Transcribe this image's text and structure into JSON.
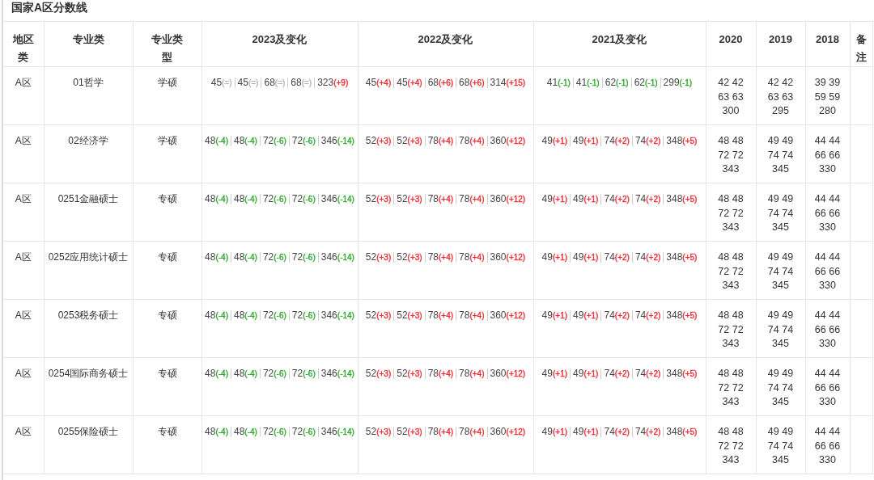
{
  "title": "国家A区分数线",
  "columns": [
    "地区类",
    "专业类",
    "专业类型",
    "2023及变化",
    "2022及变化",
    "2021及变化",
    "2020",
    "2019",
    "2018",
    "备注"
  ],
  "rows": [
    {
      "region": "A区",
      "major": "01哲学",
      "type": "学硕",
      "changes": [
        [
          {
            "value": "45",
            "delta": "(=)",
            "color": "#b3b3b3"
          },
          {
            "value": "45",
            "delta": "(=)",
            "color": "#b3b3b3"
          },
          {
            "value": "68",
            "delta": "(=)",
            "color": "#b3b3b3"
          },
          {
            "value": "68",
            "delta": "(=)",
            "color": "#b3b3b3"
          },
          {
            "value": "323",
            "delta": "(+9)",
            "color": "#f0282d"
          }
        ],
        [
          {
            "value": "45",
            "delta": "(+4)",
            "color": "#f0282d"
          },
          {
            "value": "45",
            "delta": "(+4)",
            "color": "#f0282d"
          },
          {
            "value": "68",
            "delta": "(+6)",
            "color": "#f0282d"
          },
          {
            "value": "68",
            "delta": "(+6)",
            "color": "#f0282d"
          },
          {
            "value": "314",
            "delta": "(+15)",
            "color": "#f0282d"
          }
        ],
        [
          {
            "value": "41",
            "delta": "(-1)",
            "color": "#2ea52e"
          },
          {
            "value": "41",
            "delta": "(-1)",
            "color": "#2ea52e"
          },
          {
            "value": "62",
            "delta": "(-1)",
            "color": "#2ea52e"
          },
          {
            "value": "62",
            "delta": "(-1)",
            "color": "#2ea52e"
          },
          {
            "value": "299",
            "delta": "(-1)",
            "color": "#2ea52e"
          }
        ]
      ],
      "years": [
        "42 42 63 63 300",
        "42 42 63 63 295",
        "39 39 59 59 280"
      ]
    },
    {
      "region": "A区",
      "major": "02经济学",
      "type": "学硕",
      "changes": [
        [
          {
            "value": "48",
            "delta": "(-4)",
            "color": "#2ea52e"
          },
          {
            "value": "48",
            "delta": "(-4)",
            "color": "#2ea52e"
          },
          {
            "value": "72",
            "delta": "(-6)",
            "color": "#2ea52e"
          },
          {
            "value": "72",
            "delta": "(-6)",
            "color": "#2ea52e"
          },
          {
            "value": "346",
            "delta": "(-14)",
            "color": "#2ea52e"
          }
        ],
        [
          {
            "value": "52",
            "delta": "(+3)",
            "color": "#f0282d"
          },
          {
            "value": "52",
            "delta": "(+3)",
            "color": "#f0282d"
          },
          {
            "value": "78",
            "delta": "(+4)",
            "color": "#f0282d"
          },
          {
            "value": "78",
            "delta": "(+4)",
            "color": "#f0282d"
          },
          {
            "value": "360",
            "delta": "(+12)",
            "color": "#f0282d"
          }
        ],
        [
          {
            "value": "49",
            "delta": "(+1)",
            "color": "#f0282d"
          },
          {
            "value": "49",
            "delta": "(+1)",
            "color": "#f0282d"
          },
          {
            "value": "74",
            "delta": "(+2)",
            "color": "#f0282d"
          },
          {
            "value": "74",
            "delta": "(+2)",
            "color": "#f0282d"
          },
          {
            "value": "348",
            "delta": "(+5)",
            "color": "#f0282d"
          }
        ]
      ],
      "years": [
        "48 48 72 72 343",
        "49 49 74 74 345",
        "44 44 66 66 330"
      ]
    },
    {
      "region": "A区",
      "major": "0251金融硕士",
      "type": "专硕",
      "changes": [
        [
          {
            "value": "48",
            "delta": "(-4)",
            "color": "#2ea52e"
          },
          {
            "value": "48",
            "delta": "(-4)",
            "color": "#2ea52e"
          },
          {
            "value": "72",
            "delta": "(-6)",
            "color": "#2ea52e"
          },
          {
            "value": "72",
            "delta": "(-6)",
            "color": "#2ea52e"
          },
          {
            "value": "346",
            "delta": "(-14)",
            "color": "#2ea52e"
          }
        ],
        [
          {
            "value": "52",
            "delta": "(+3)",
            "color": "#f0282d"
          },
          {
            "value": "52",
            "delta": "(+3)",
            "color": "#f0282d"
          },
          {
            "value": "78",
            "delta": "(+4)",
            "color": "#f0282d"
          },
          {
            "value": "78",
            "delta": "(+4)",
            "color": "#f0282d"
          },
          {
            "value": "360",
            "delta": "(+12)",
            "color": "#f0282d"
          }
        ],
        [
          {
            "value": "49",
            "delta": "(+1)",
            "color": "#f0282d"
          },
          {
            "value": "49",
            "delta": "(+1)",
            "color": "#f0282d"
          },
          {
            "value": "74",
            "delta": "(+2)",
            "color": "#f0282d"
          },
          {
            "value": "74",
            "delta": "(+2)",
            "color": "#f0282d"
          },
          {
            "value": "348",
            "delta": "(+5)",
            "color": "#f0282d"
          }
        ]
      ],
      "years": [
        "48 48 72 72 343",
        "49 49 74 74 345",
        "44 44 66 66 330"
      ]
    },
    {
      "region": "A区",
      "major": "0252应用统计硕士",
      "type": "专硕",
      "changes": [
        [
          {
            "value": "48",
            "delta": "(-4)",
            "color": "#2ea52e"
          },
          {
            "value": "48",
            "delta": "(-4)",
            "color": "#2ea52e"
          },
          {
            "value": "72",
            "delta": "(-6)",
            "color": "#2ea52e"
          },
          {
            "value": "72",
            "delta": "(-6)",
            "color": "#2ea52e"
          },
          {
            "value": "346",
            "delta": "(-14)",
            "color": "#2ea52e"
          }
        ],
        [
          {
            "value": "52",
            "delta": "(+3)",
            "color": "#f0282d"
          },
          {
            "value": "52",
            "delta": "(+3)",
            "color": "#f0282d"
          },
          {
            "value": "78",
            "delta": "(+4)",
            "color": "#f0282d"
          },
          {
            "value": "78",
            "delta": "(+4)",
            "color": "#f0282d"
          },
          {
            "value": "360",
            "delta": "(+12)",
            "color": "#f0282d"
          }
        ],
        [
          {
            "value": "49",
            "delta": "(+1)",
            "color": "#f0282d"
          },
          {
            "value": "49",
            "delta": "(+1)",
            "color": "#f0282d"
          },
          {
            "value": "74",
            "delta": "(+2)",
            "color": "#f0282d"
          },
          {
            "value": "74",
            "delta": "(+2)",
            "color": "#f0282d"
          },
          {
            "value": "348",
            "delta": "(+5)",
            "color": "#f0282d"
          }
        ]
      ],
      "years": [
        "48 48 72 72 343",
        "49 49 74 74 345",
        "44 44 66 66 330"
      ]
    },
    {
      "region": "A区",
      "major": "0253税务硕士",
      "type": "专硕",
      "changes": [
        [
          {
            "value": "48",
            "delta": "(-4)",
            "color": "#2ea52e"
          },
          {
            "value": "48",
            "delta": "(-4)",
            "color": "#2ea52e"
          },
          {
            "value": "72",
            "delta": "(-6)",
            "color": "#2ea52e"
          },
          {
            "value": "72",
            "delta": "(-6)",
            "color": "#2ea52e"
          },
          {
            "value": "346",
            "delta": "(-14)",
            "color": "#2ea52e"
          }
        ],
        [
          {
            "value": "52",
            "delta": "(+3)",
            "color": "#f0282d"
          },
          {
            "value": "52",
            "delta": "(+3)",
            "color": "#f0282d"
          },
          {
            "value": "78",
            "delta": "(+4)",
            "color": "#f0282d"
          },
          {
            "value": "78",
            "delta": "(+4)",
            "color": "#f0282d"
          },
          {
            "value": "360",
            "delta": "(+12)",
            "color": "#f0282d"
          }
        ],
        [
          {
            "value": "49",
            "delta": "(+1)",
            "color": "#f0282d"
          },
          {
            "value": "49",
            "delta": "(+1)",
            "color": "#f0282d"
          },
          {
            "value": "74",
            "delta": "(+2)",
            "color": "#f0282d"
          },
          {
            "value": "74",
            "delta": "(+2)",
            "color": "#f0282d"
          },
          {
            "value": "348",
            "delta": "(+5)",
            "color": "#f0282d"
          }
        ]
      ],
      "years": [
        "48 48 72 72 343",
        "49 49 74 74 345",
        "44 44 66 66 330"
      ]
    },
    {
      "region": "A区",
      "major": "0254国际商务硕士",
      "type": "专硕",
      "changes": [
        [
          {
            "value": "48",
            "delta": "(-4)",
            "color": "#2ea52e"
          },
          {
            "value": "48",
            "delta": "(-4)",
            "color": "#2ea52e"
          },
          {
            "value": "72",
            "delta": "(-6)",
            "color": "#2ea52e"
          },
          {
            "value": "72",
            "delta": "(-6)",
            "color": "#2ea52e"
          },
          {
            "value": "346",
            "delta": "(-14)",
            "color": "#2ea52e"
          }
        ],
        [
          {
            "value": "52",
            "delta": "(+3)",
            "color": "#f0282d"
          },
          {
            "value": "52",
            "delta": "(+3)",
            "color": "#f0282d"
          },
          {
            "value": "78",
            "delta": "(+4)",
            "color": "#f0282d"
          },
          {
            "value": "78",
            "delta": "(+4)",
            "color": "#f0282d"
          },
          {
            "value": "360",
            "delta": "(+12)",
            "color": "#f0282d"
          }
        ],
        [
          {
            "value": "49",
            "delta": "(+1)",
            "color": "#f0282d"
          },
          {
            "value": "49",
            "delta": "(+1)",
            "color": "#f0282d"
          },
          {
            "value": "74",
            "delta": "(+2)",
            "color": "#f0282d"
          },
          {
            "value": "74",
            "delta": "(+2)",
            "color": "#f0282d"
          },
          {
            "value": "348",
            "delta": "(+5)",
            "color": "#f0282d"
          }
        ]
      ],
      "years": [
        "48 48 72 72 343",
        "49 49 74 74 345",
        "44 44 66 66 330"
      ]
    },
    {
      "region": "A区",
      "major": "0255保险硕士",
      "type": "专硕",
      "changes": [
        [
          {
            "value": "48",
            "delta": "(-4)",
            "color": "#2ea52e"
          },
          {
            "value": "48",
            "delta": "(-4)",
            "color": "#2ea52e"
          },
          {
            "value": "72",
            "delta": "(-6)",
            "color": "#2ea52e"
          },
          {
            "value": "72",
            "delta": "(-6)",
            "color": "#2ea52e"
          },
          {
            "value": "346",
            "delta": "(-14)",
            "color": "#2ea52e"
          }
        ],
        [
          {
            "value": "52",
            "delta": "(+3)",
            "color": "#f0282d"
          },
          {
            "value": "52",
            "delta": "(+3)",
            "color": "#f0282d"
          },
          {
            "value": "78",
            "delta": "(+4)",
            "color": "#f0282d"
          },
          {
            "value": "78",
            "delta": "(+4)",
            "color": "#f0282d"
          },
          {
            "value": "360",
            "delta": "(+12)",
            "color": "#f0282d"
          }
        ],
        [
          {
            "value": "49",
            "delta": "(+1)",
            "color": "#f0282d"
          },
          {
            "value": "49",
            "delta": "(+1)",
            "color": "#f0282d"
          },
          {
            "value": "74",
            "delta": "(+2)",
            "color": "#f0282d"
          },
          {
            "value": "74",
            "delta": "(+2)",
            "color": "#f0282d"
          },
          {
            "value": "348",
            "delta": "(+5)",
            "color": "#f0282d"
          }
        ]
      ],
      "years": [
        "48 48 72 72 343",
        "49 49 74 74 345",
        "44 44 66 66 330"
      ]
    }
  ]
}
